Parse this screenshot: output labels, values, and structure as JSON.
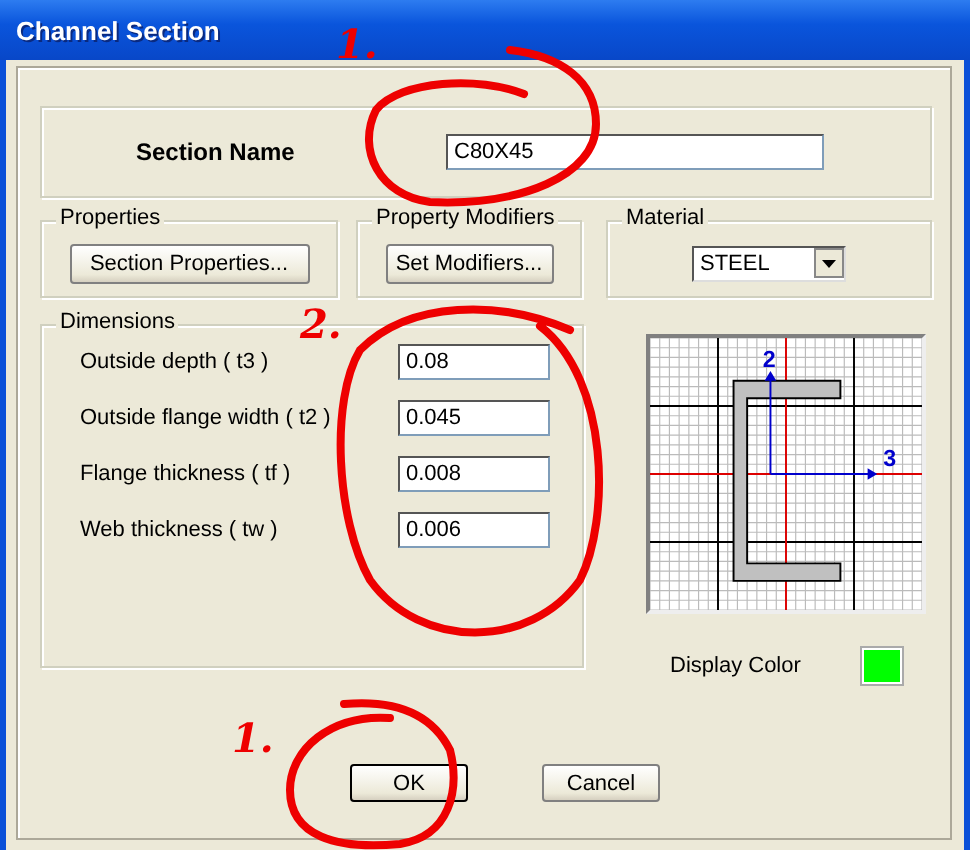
{
  "window": {
    "title": "Channel Section"
  },
  "section_name": {
    "label": "Section Name",
    "value": "C80X45"
  },
  "properties": {
    "title": "Properties",
    "button": "Section Properties..."
  },
  "property_modifiers": {
    "title": "Property Modifiers",
    "button": "Set Modifiers..."
  },
  "material": {
    "title": "Material",
    "value": "STEEL"
  },
  "dimensions": {
    "title": "Dimensions",
    "fields": [
      {
        "label": "Outside depth  ( t3 )",
        "value": "0.08"
      },
      {
        "label": "Outside flange width  ( t2 )",
        "value": "0.045"
      },
      {
        "label": "Flange thickness  ( tf )",
        "value": "0.008"
      },
      {
        "label": "Web thickness  ( tw )",
        "value": "0.006"
      }
    ]
  },
  "preview": {
    "axis_labels": [
      "2",
      "3"
    ]
  },
  "display_color": {
    "label": "Display Color",
    "color": "#00ff00"
  },
  "buttons": [
    "OK",
    "Cancel"
  ],
  "annotations": [
    {
      "label": "1."
    },
    {
      "label": "2."
    },
    {
      "label": "1."
    }
  ]
}
